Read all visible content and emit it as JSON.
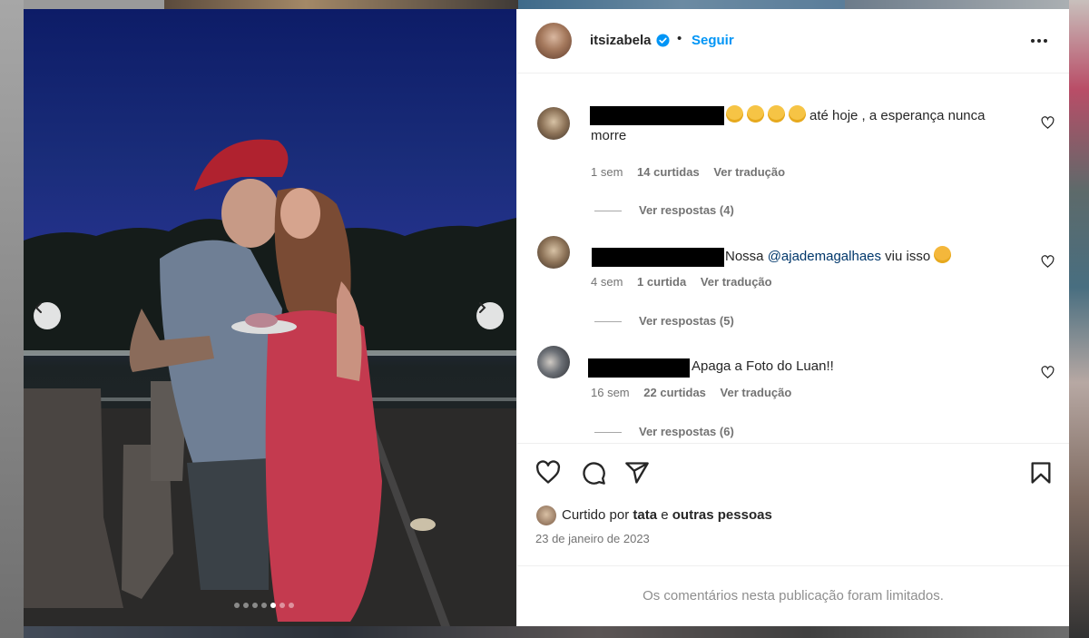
{
  "post": {
    "username": "itsizabela",
    "separator": "•",
    "follow_label": "Seguir",
    "carousel": {
      "total_slides": 7,
      "active_index": 4
    }
  },
  "comments": [
    {
      "text_after": "até hoje , a esperança nunca",
      "text_line2": "morre",
      "emoji_count": 4,
      "time": "1 sem",
      "likes": "14 curtidas",
      "translate": "Ver tradução",
      "replies": "Ver respostas (4)"
    },
    {
      "text_before": "Nossa ",
      "mention": "@ajademagalhaes",
      "text_after": " viu isso ",
      "time": "4 sem",
      "likes": "1 curtida",
      "translate": "Ver tradução",
      "replies": "Ver respostas (5)"
    },
    {
      "text_after": "Apaga a Foto do Luan!!",
      "time": "16 sem",
      "likes": "22 curtidas",
      "translate": "Ver tradução",
      "replies": "Ver respostas (6)"
    }
  ],
  "footer": {
    "liked_prefix": "Curtido por ",
    "liked_user": "tata",
    "liked_mid": " e ",
    "liked_others": "outras pessoas",
    "date": "23 de janeiro de 2023",
    "limited_notice": "Os comentários nesta publicação foram limitados."
  },
  "icons": {
    "verified": "verified-badge-icon",
    "more": "more-options-icon",
    "like": "heart-icon",
    "comment": "comment-icon",
    "share": "share-icon",
    "save": "bookmark-icon",
    "prev": "chevron-left-icon",
    "next": "chevron-right-icon"
  },
  "colors": {
    "accent": "#0095f6",
    "mention": "#00376b",
    "muted": "#737373"
  }
}
